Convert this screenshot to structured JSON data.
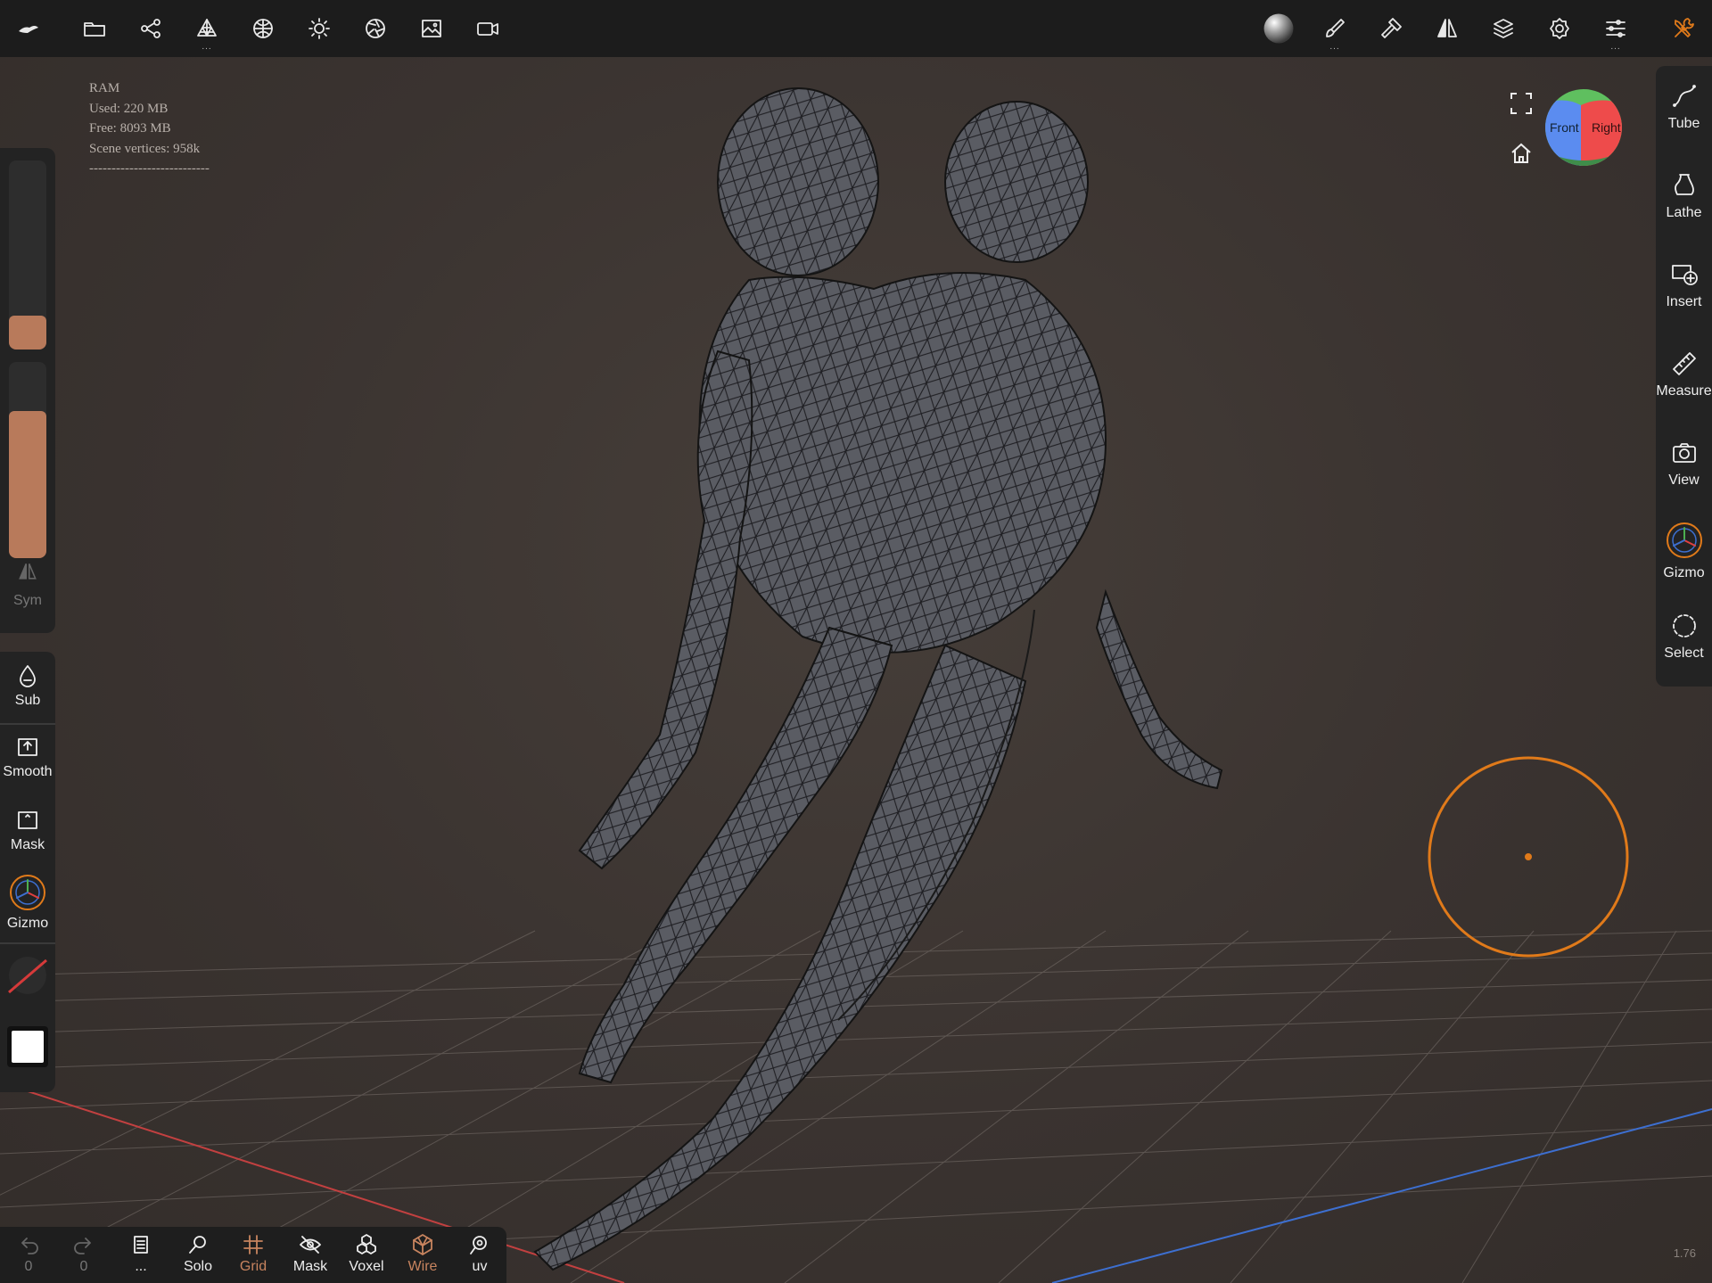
{
  "topbar": {
    "left_icons": [
      "app-logo-icon",
      "folder-icon",
      "scene-graph-icon",
      "topology-icon",
      "material-sphere-icon",
      "light-icon",
      "shading-icon",
      "background-image-icon",
      "camera-icon"
    ],
    "right_icons": [
      "matcap-preview-icon",
      "paint-brush-icon",
      "hammer-icon",
      "symmetry-icon",
      "layers-icon",
      "settings-icon",
      "sliders-icon",
      "tools-icon"
    ],
    "more_indicator": "..."
  },
  "ram": {
    "title": "RAM",
    "used": "Used: 220 MB",
    "free": "Free: 8093 MB",
    "vertices": "Scene vertices: 958k",
    "divider": "---------------------------"
  },
  "left_panel": {
    "radius_fill": 0.18,
    "intensity_fill": 0.75,
    "sym_label": "Sym",
    "tools": [
      {
        "label": "Sub",
        "icon": "drop-icon"
      },
      {
        "label": "Smooth",
        "icon": "smooth-icon"
      },
      {
        "label": "Mask",
        "icon": "mask-icon"
      },
      {
        "label": "Gizmo",
        "icon": "gizmo-icon"
      }
    ],
    "color_swatch": "#ffffff"
  },
  "right_panel": {
    "tools": [
      {
        "label": "Tube",
        "icon": "tube-icon"
      },
      {
        "label": "Lathe",
        "icon": "lathe-icon"
      },
      {
        "label": "Insert",
        "icon": "insert-icon"
      },
      {
        "label": "Measure",
        "icon": "ruler-icon"
      },
      {
        "label": "View",
        "icon": "camera-view-icon"
      },
      {
        "label": "Gizmo",
        "icon": "gizmo-icon"
      },
      {
        "label": "Select",
        "icon": "select-icon"
      }
    ]
  },
  "navcube": {
    "front": "Front",
    "right": "Right"
  },
  "bottom_bar": {
    "undo_count": "0",
    "redo_count": "0",
    "history_more": "...",
    "tools": [
      {
        "label": "Solo",
        "icon": "search-icon",
        "state": "normal"
      },
      {
        "label": "Grid",
        "icon": "grid-icon",
        "state": "accent"
      },
      {
        "label": "Mask",
        "icon": "eye-slash-icon",
        "state": "normal"
      },
      {
        "label": "Voxel",
        "icon": "voxel-icon",
        "state": "normal"
      },
      {
        "label": "Wire",
        "icon": "wireframe-icon",
        "state": "accent"
      },
      {
        "label": "uv",
        "icon": "uv-icon",
        "state": "normal"
      }
    ]
  },
  "version": "1.76",
  "colors": {
    "accent": "#c8845f",
    "brush_cursor": "#e07a1a",
    "toolbar": "#1c1c1c"
  }
}
